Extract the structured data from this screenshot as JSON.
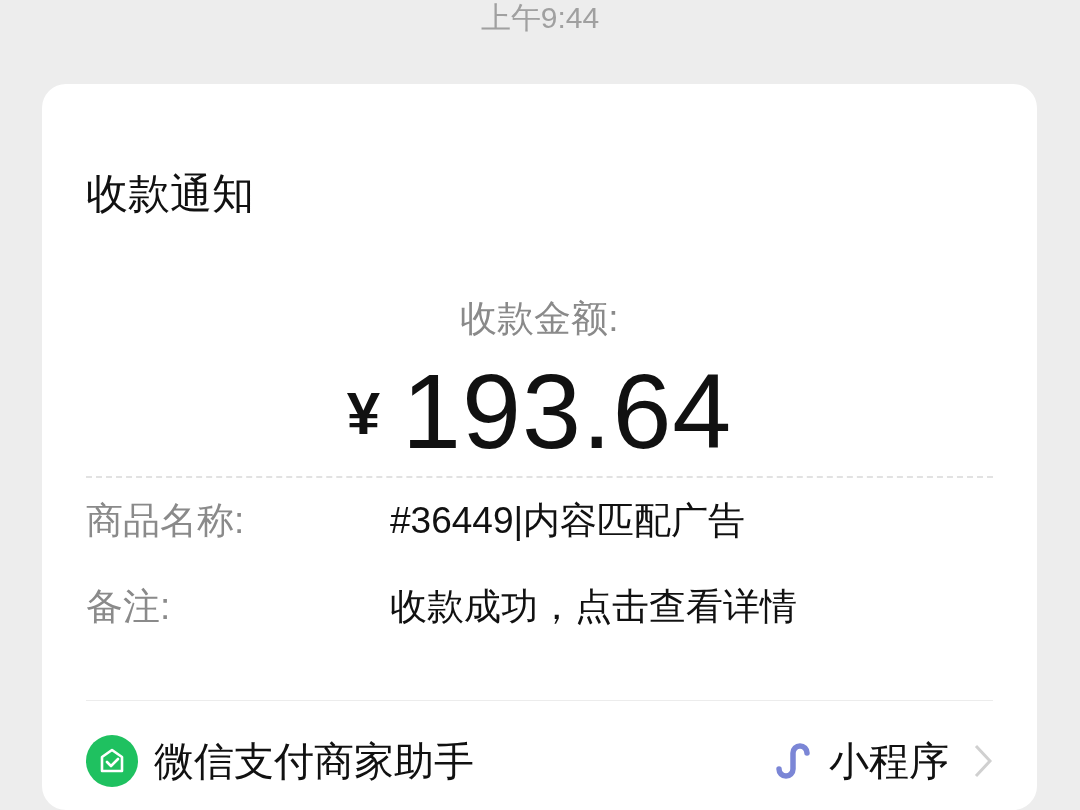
{
  "time": "上午9:44",
  "card": {
    "title": "收款通知",
    "amount_label": "收款金额:",
    "currency": "¥",
    "amount": "193.64",
    "fields": [
      {
        "label": "商品名称:",
        "value": "#36449|内容匹配广告"
      },
      {
        "label": "备注:",
        "value": "收款成功，点击查看详情"
      }
    ],
    "footer": {
      "source": "微信支付商家助手",
      "mini_program": "小程序"
    }
  }
}
